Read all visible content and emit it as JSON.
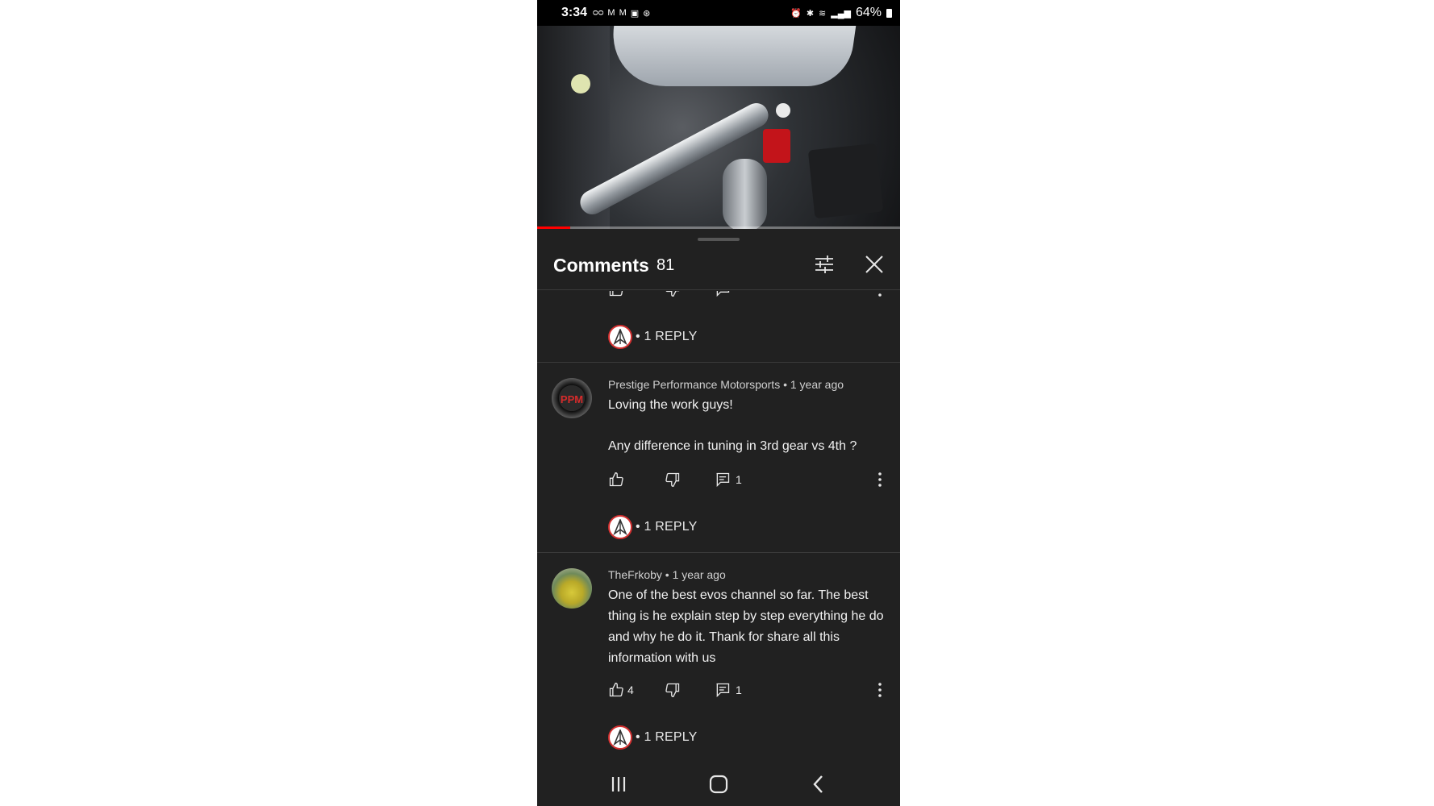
{
  "status_bar": {
    "time": "3:34",
    "battery": "64%",
    "left_icons": [
      "voicemail-icon",
      "gmail-icon",
      "gmail-icon",
      "gallery-icon",
      "sync-icon"
    ],
    "right_icons": [
      "alarm-icon",
      "bluetooth-icon",
      "wifi-icon",
      "signal-icon",
      "battery-icon"
    ]
  },
  "video": {
    "progress_percent": 9
  },
  "comments": {
    "title": "Comments",
    "count": "81",
    "items": [
      {
        "reply_label": "• 1 REPLY"
      },
      {
        "author_meta": "Prestige Performance Motorsports • 1 year ago",
        "text_line1": "Loving the work guys!",
        "text_line2": "Any difference in tuning in 3rd gear vs 4th ?",
        "like_count": "",
        "reply_count": "1",
        "reply_label": "• 1 REPLY"
      },
      {
        "author_meta": "TheFrkoby • 1 year ago",
        "text": "One of the best evos channel so far. The best thing is he explain step by step everything he do and why he do it. Thank for share all this information with us",
        "like_count": "4",
        "reply_count": "1",
        "reply_label": "• 1 REPLY"
      }
    ]
  },
  "colors": {
    "background": "#212121",
    "accent": "#ff0000",
    "text": "#f1f1f1"
  }
}
